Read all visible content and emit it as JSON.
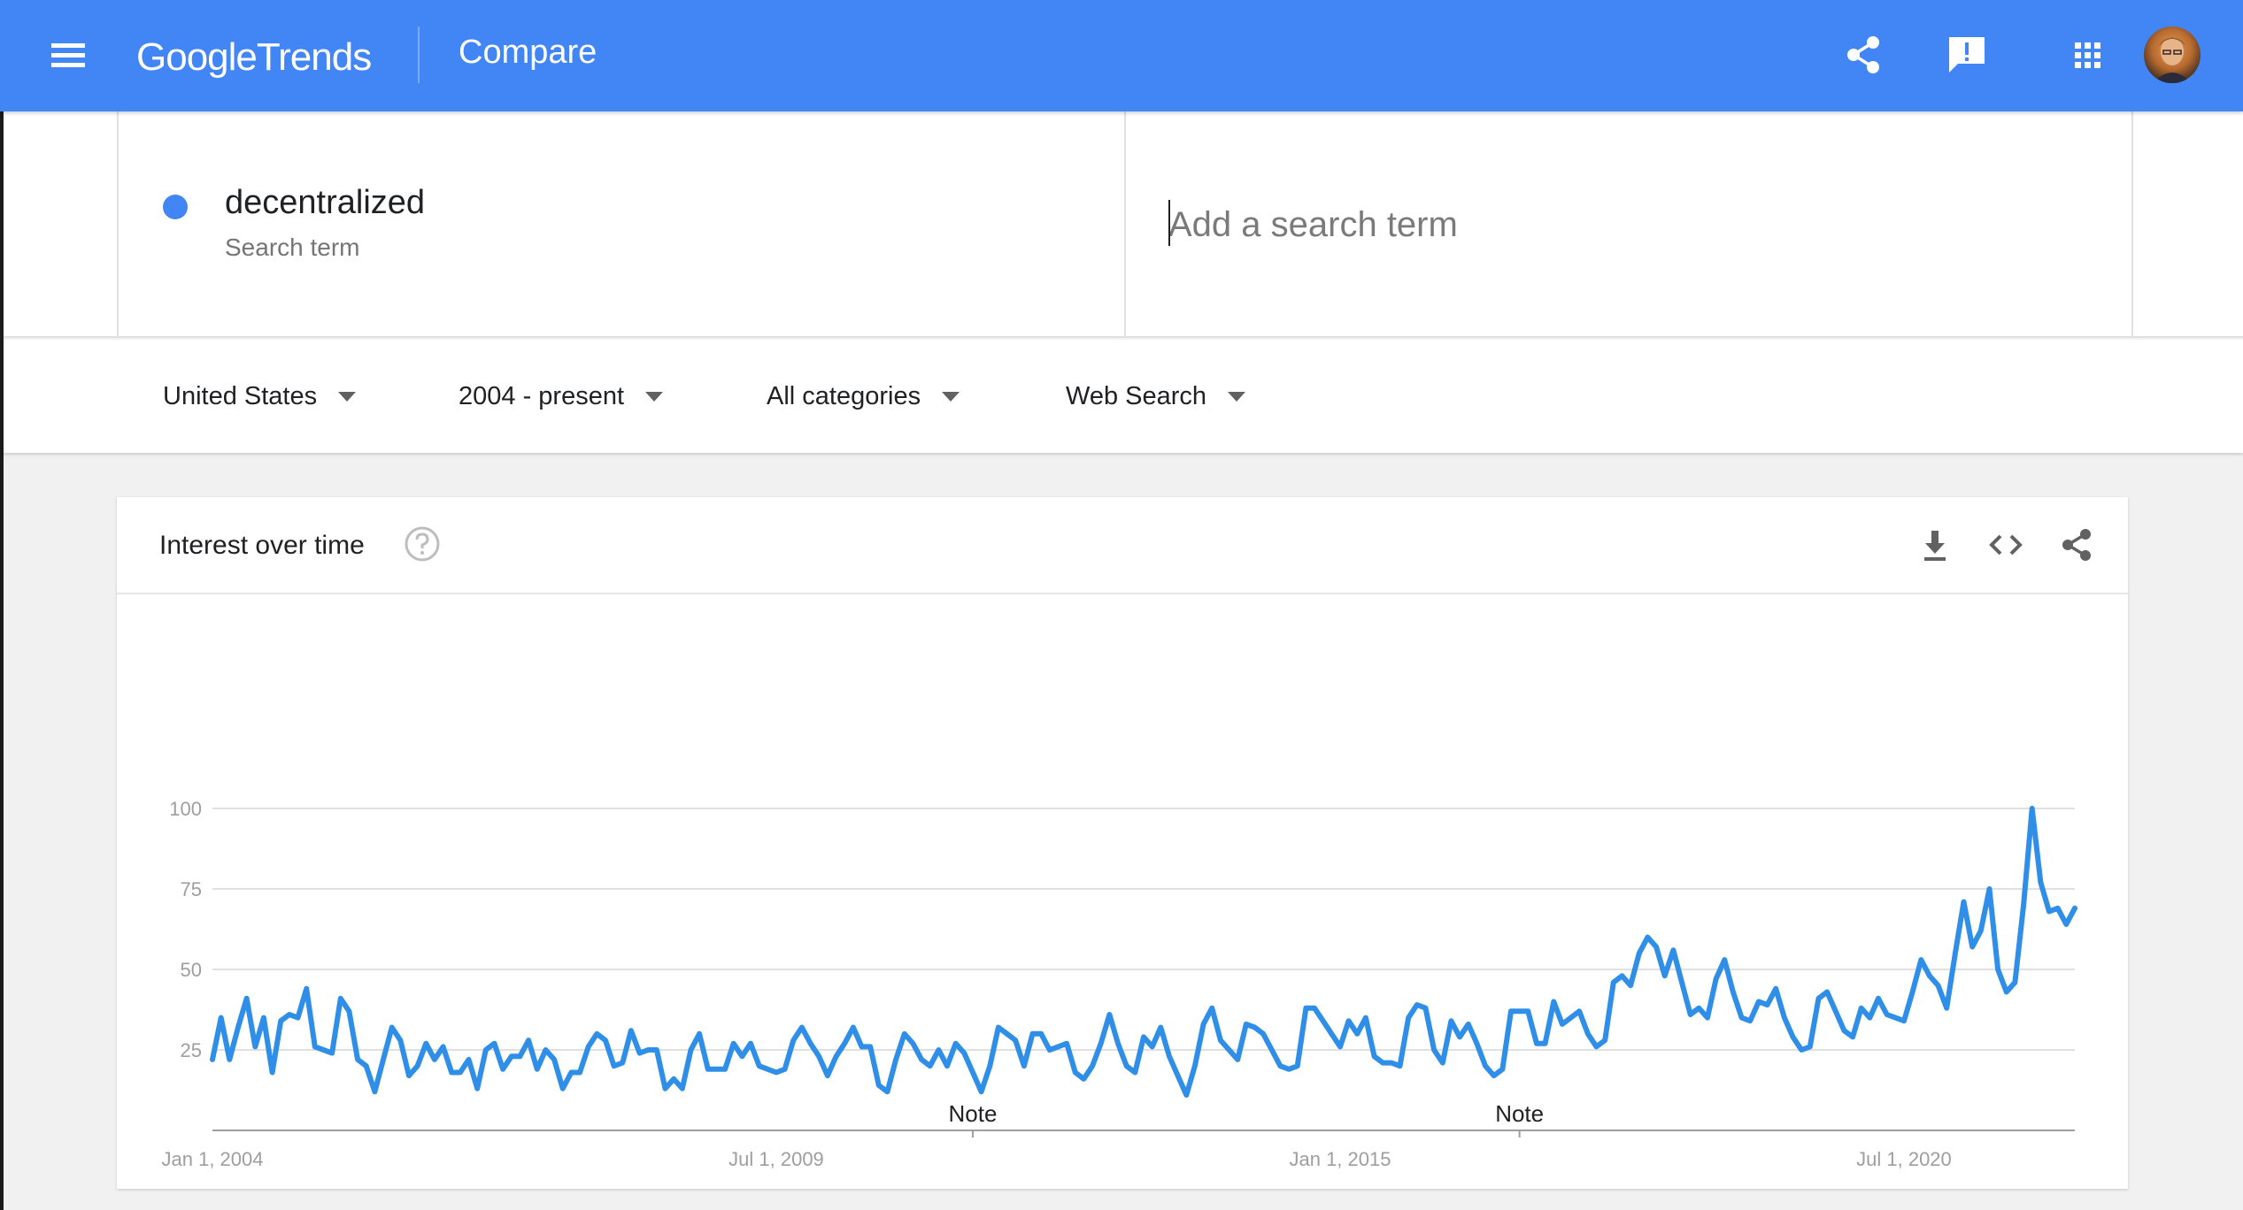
{
  "header": {
    "logo_google": "Google",
    "logo_trends": "Trends",
    "page_title": "Compare",
    "icons": [
      "menu-icon",
      "share-icon",
      "feedback-icon",
      "apps-grid-icon",
      "avatar"
    ]
  },
  "terms": {
    "term": {
      "name": "decentralized",
      "sublabel": "Search term",
      "color": "#4285f4"
    },
    "add_placeholder": "Add a search term"
  },
  "filters": {
    "region": "United States",
    "time": "2004 - present",
    "category": "All categories",
    "property": "Web Search"
  },
  "card": {
    "title": "Interest over time"
  },
  "chart_data": {
    "type": "line",
    "series": [
      {
        "name": "decentralized",
        "color": "#2f8fe8",
        "start": "2004-01",
        "interval": "month",
        "values": [
          22,
          35,
          22,
          32,
          41,
          26,
          35,
          18,
          34,
          36,
          35,
          44,
          26,
          25,
          24,
          41,
          37,
          22,
          20,
          12,
          22,
          32,
          28,
          17,
          20,
          27,
          22,
          26,
          18,
          18,
          22,
          13,
          25,
          27,
          19,
          23,
          23,
          28,
          19,
          25,
          22,
          13,
          18,
          18,
          26,
          30,
          28,
          20,
          21,
          31,
          24,
          25,
          25,
          13,
          16,
          13,
          25,
          30,
          19,
          19,
          19,
          27,
          23,
          27,
          20,
          19,
          18,
          19,
          28,
          32,
          27,
          23,
          17,
          23,
          27,
          32,
          26,
          26,
          14,
          12,
          22,
          30,
          27,
          22,
          20,
          25,
          20,
          27,
          24,
          18,
          12,
          20,
          32,
          30,
          28,
          20,
          30,
          30,
          25,
          26,
          27,
          18,
          16,
          20,
          27,
          36,
          27,
          20,
          18,
          29,
          26,
          32,
          23,
          17,
          11,
          20,
          33,
          38,
          28,
          25,
          22,
          33,
          32,
          30,
          25,
          20,
          19,
          20,
          38,
          38,
          34,
          30,
          26,
          34,
          30,
          35,
          23,
          21,
          21,
          20,
          35,
          39,
          38,
          25,
          21,
          34,
          29,
          33,
          27,
          20,
          17,
          19,
          37,
          37,
          37,
          27,
          27,
          40,
          33,
          35,
          37,
          30,
          26,
          28,
          46,
          48,
          45,
          55,
          60,
          57,
          48,
          56,
          46,
          36,
          38,
          35,
          47,
          53,
          43,
          35,
          34,
          40,
          39,
          44,
          35,
          29,
          25,
          26,
          41,
          43,
          37,
          31,
          29,
          38,
          35,
          41,
          36,
          35,
          34,
          43,
          53,
          48,
          45,
          38,
          55,
          71,
          57,
          62,
          75,
          50,
          43,
          46,
          70,
          100,
          77,
          68,
          69,
          64,
          69
        ]
      }
    ],
    "x_ticks": [
      "Jan 1, 2004",
      "Jul 1, 2009",
      "Jan 1, 2015",
      "Jul 1, 2020"
    ],
    "y_ticks": [
      100,
      75,
      50,
      25
    ],
    "ylim": [
      0,
      100
    ],
    "annotations": [
      {
        "label": "Note",
        "x": "2011-06"
      },
      {
        "label": "Note",
        "x": "2016-10"
      }
    ],
    "grid": true,
    "xlabel": "",
    "ylabel": ""
  }
}
